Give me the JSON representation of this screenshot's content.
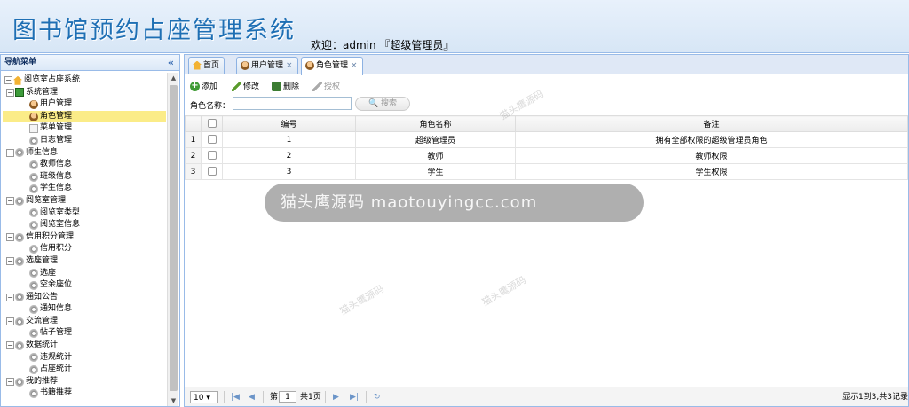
{
  "header": {
    "title": "图书馆预约占座管理系统",
    "welcome": "欢迎：admin 『超级管理员』"
  },
  "sidebar": {
    "title": "导航菜单",
    "collapse_icon": "«",
    "tree": [
      {
        "label": "阅览室占座系统",
        "level": 0,
        "icon": "home-icon",
        "toggle": "−"
      },
      {
        "label": "系统管理",
        "level": 1,
        "icon": "folder-icon",
        "toggle": "−"
      },
      {
        "label": "用户管理",
        "level": 2,
        "icon": "user-icon"
      },
      {
        "label": "角色管理",
        "level": 2,
        "icon": "role-icon",
        "selected": true
      },
      {
        "label": "菜单管理",
        "level": 2,
        "icon": "menu-icon"
      },
      {
        "label": "日志管理",
        "level": 2,
        "icon": "gear-icon"
      },
      {
        "label": "师生信息",
        "level": 1,
        "icon": "gear-icon",
        "toggle": "−"
      },
      {
        "label": "教师信息",
        "level": 2,
        "icon": "gear-icon"
      },
      {
        "label": "班级信息",
        "level": 2,
        "icon": "gear-icon"
      },
      {
        "label": "学生信息",
        "level": 2,
        "icon": "gear-icon"
      },
      {
        "label": "阅览室管理",
        "level": 1,
        "icon": "gear-icon",
        "toggle": "−"
      },
      {
        "label": "阅览室类型",
        "level": 2,
        "icon": "gear-icon"
      },
      {
        "label": "阅览室信息",
        "level": 2,
        "icon": "gear-icon"
      },
      {
        "label": "信用积分管理",
        "level": 1,
        "icon": "gear-icon",
        "toggle": "−"
      },
      {
        "label": "信用积分",
        "level": 2,
        "icon": "gear-icon"
      },
      {
        "label": "选座管理",
        "level": 1,
        "icon": "gear-icon",
        "toggle": "−"
      },
      {
        "label": "选座",
        "level": 2,
        "icon": "gear-icon"
      },
      {
        "label": "空余座位",
        "level": 2,
        "icon": "gear-icon"
      },
      {
        "label": "通知公告",
        "level": 1,
        "icon": "gear-icon",
        "toggle": "−"
      },
      {
        "label": "通知信息",
        "level": 2,
        "icon": "gear-icon"
      },
      {
        "label": "交流管理",
        "level": 1,
        "icon": "gear-icon",
        "toggle": "−"
      },
      {
        "label": "帖子管理",
        "level": 2,
        "icon": "gear-icon"
      },
      {
        "label": "数据统计",
        "level": 1,
        "icon": "gear-icon",
        "toggle": "−"
      },
      {
        "label": "违规统计",
        "level": 2,
        "icon": "gear-icon"
      },
      {
        "label": "占座统计",
        "level": 2,
        "icon": "gear-icon"
      },
      {
        "label": "我的推荐",
        "level": 1,
        "icon": "gear-icon",
        "toggle": "−"
      },
      {
        "label": "书籍推荐",
        "level": 2,
        "icon": "gear-icon"
      }
    ]
  },
  "tabs": [
    {
      "label": "首页",
      "closable": false,
      "icon": "home-icon"
    },
    {
      "label": "用户管理",
      "closable": true,
      "icon": "user-icon"
    },
    {
      "label": "角色管理",
      "closable": true,
      "icon": "role-icon",
      "active": true
    }
  ],
  "toolbar": {
    "add": "添加",
    "edit": "修改",
    "delete": "删除",
    "authorize": "授权"
  },
  "search": {
    "label": "角色名称：",
    "value": "",
    "button": "搜索"
  },
  "grid": {
    "columns": [
      "编号",
      "角色名称",
      "备注"
    ],
    "rows": [
      {
        "row_num": "1",
        "id": "1",
        "name": "超级管理员",
        "remark": "拥有全部权限的超级管理员角色"
      },
      {
        "row_num": "2",
        "id": "2",
        "name": "教师",
        "remark": "教师权限"
      },
      {
        "row_num": "3",
        "id": "3",
        "name": "学生",
        "remark": "学生权限"
      }
    ]
  },
  "pager": {
    "page_size": "10 ▾",
    "page_prefix": "第",
    "page_value": "1",
    "page_suffix": "共1页",
    "summary": "显示1到3,共3记录"
  },
  "watermark": {
    "band_text": "猫头鹰源码 maotouyingcc.com",
    "small_text": "猫头鹰源码"
  },
  "colors": {
    "header_bg": "#dbe8f6",
    "title_color": "#1e6fb4",
    "border": "#99bbe8",
    "selected_row": "#fbec88"
  }
}
